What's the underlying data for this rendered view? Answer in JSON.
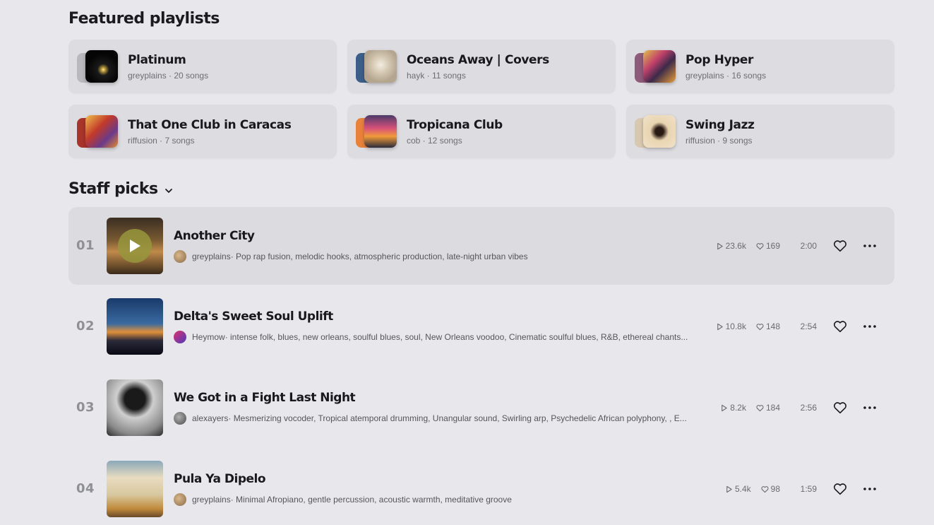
{
  "featured": {
    "title": "Featured playlists",
    "playlists": [
      {
        "name": "Platinum",
        "meta": "greyplains · 20 songs"
      },
      {
        "name": "Oceans Away | Covers",
        "meta": "hayk · 11 songs"
      },
      {
        "name": "Pop Hyper",
        "meta": "greyplains · 16 songs"
      },
      {
        "name": "That One Club in Caracas",
        "meta": "riffusion · 7 songs"
      },
      {
        "name": "Tropicana Club",
        "meta": "cob · 12 songs"
      },
      {
        "name": "Swing Jazz",
        "meta": "riffusion · 9 songs"
      }
    ]
  },
  "staff": {
    "title": "Staff picks",
    "tracks": [
      {
        "num": "01",
        "title": "Another City",
        "user": "greyplains",
        "desc": " · Pop rap fusion, melodic hooks, atmospheric production, late-night urban vibes",
        "plays": "23.6k",
        "likes": "169",
        "duration": "2:00"
      },
      {
        "num": "02",
        "title": "Delta's Sweet Soul Uplift",
        "user": "Heymow",
        "desc": " · intense folk, blues, new orleans, soulful blues, soul, New Orleans voodoo, Cinematic soulful blues, R&B, ethereal chants...",
        "plays": "10.8k",
        "likes": "148",
        "duration": "2:54"
      },
      {
        "num": "03",
        "title": "We Got in a Fight Last Night",
        "user": "alexayers",
        "desc": " · Mesmerizing vocoder, Tropical atemporal drumming, Unangular sound, Swirling arp, Psychedelic African polyphony, , E...",
        "plays": "8.2k",
        "likes": "184",
        "duration": "2:56"
      },
      {
        "num": "04",
        "title": "Pula Ya Dipelo",
        "user": "greyplains",
        "desc": " · Minimal Afropiano, gentle percussion, acoustic warmth, meditative groove",
        "plays": "5.4k",
        "likes": "98",
        "duration": "1:59"
      }
    ]
  },
  "icons": [
    "chevron-down-icon",
    "play-icon",
    "heart-icon",
    "more-icon"
  ],
  "colors": {
    "background": "#e8e7eb",
    "card": "#dddce1",
    "play_overlay": "#96963c"
  }
}
